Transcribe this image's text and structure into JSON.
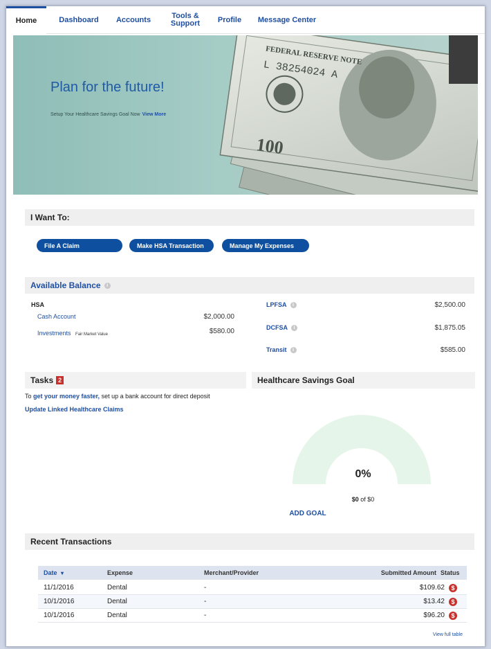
{
  "nav": {
    "tabs": [
      {
        "label": "Home"
      },
      {
        "label": "Dashboard"
      },
      {
        "label": "Accounts"
      },
      {
        "label": "Tools & Support"
      },
      {
        "label": "Profile"
      },
      {
        "label": "Message Center"
      }
    ]
  },
  "hero": {
    "title": "Plan for the future!",
    "subtitle": "Setup Your Healthcare Savings Goal Now",
    "link": "View More",
    "bill_serial": "L 38254024 A",
    "bill_header": "FEDERAL RESERVE NOTE",
    "bill_denomination": "100"
  },
  "want": {
    "title": "I Want To:",
    "buttons": [
      "File A Claim",
      "Make HSA Transaction",
      "Manage My Expenses"
    ]
  },
  "balance": {
    "title": "Available Balance",
    "hsa_label": "HSA",
    "cash_label": "Cash Account",
    "cash_value": "$2,000.00",
    "inv_label": "Investments",
    "inv_note": "Fair Market Value",
    "inv_value": "$580.00",
    "lpfsa_label": "LPFSA",
    "lpfsa_value": "$2,500.00",
    "dcfsa_label": "DCFSA",
    "dcfsa_value": "$1,875.05",
    "transit_label": "Transit",
    "transit_value": "$585.00"
  },
  "tasks": {
    "title": "Tasks",
    "count": "2",
    "line_pre": "To",
    "line_link": "get your money faster,",
    "line_post": "set up a bank account for direct deposit",
    "update_link": "Update Linked Healthcare Claims"
  },
  "goal": {
    "title": "Healthcare Savings Goal",
    "percent": "0%",
    "progress": 0,
    "amount_bold": "$0",
    "amount_rest": "of $0",
    "add_label": "ADD GOAL",
    "arc_color": "#e6f5ea"
  },
  "transactions": {
    "title": "Recent Transactions",
    "headers": {
      "date": "Date",
      "sort_icon": "▾",
      "expense": "Expense",
      "merchant": "Merchant/Provider",
      "amount": "Submitted Amount",
      "status": "Status"
    },
    "rows": [
      {
        "date": "11/1/2016",
        "expense": "Dental",
        "merchant": "-",
        "amount": "$109.62",
        "status_icon": "$"
      },
      {
        "date": "10/1/2016",
        "expense": "Dental",
        "merchant": "-",
        "amount": "$13.42",
        "status_icon": "$"
      },
      {
        "date": "10/1/2016",
        "expense": "Dental",
        "merchant": "-",
        "amount": "$96.20",
        "status_icon": "$"
      }
    ],
    "view_full": "View full table"
  },
  "colors": {
    "brand": "#1f4fa1",
    "button": "#0f4fa0",
    "status": "#c9302c"
  }
}
